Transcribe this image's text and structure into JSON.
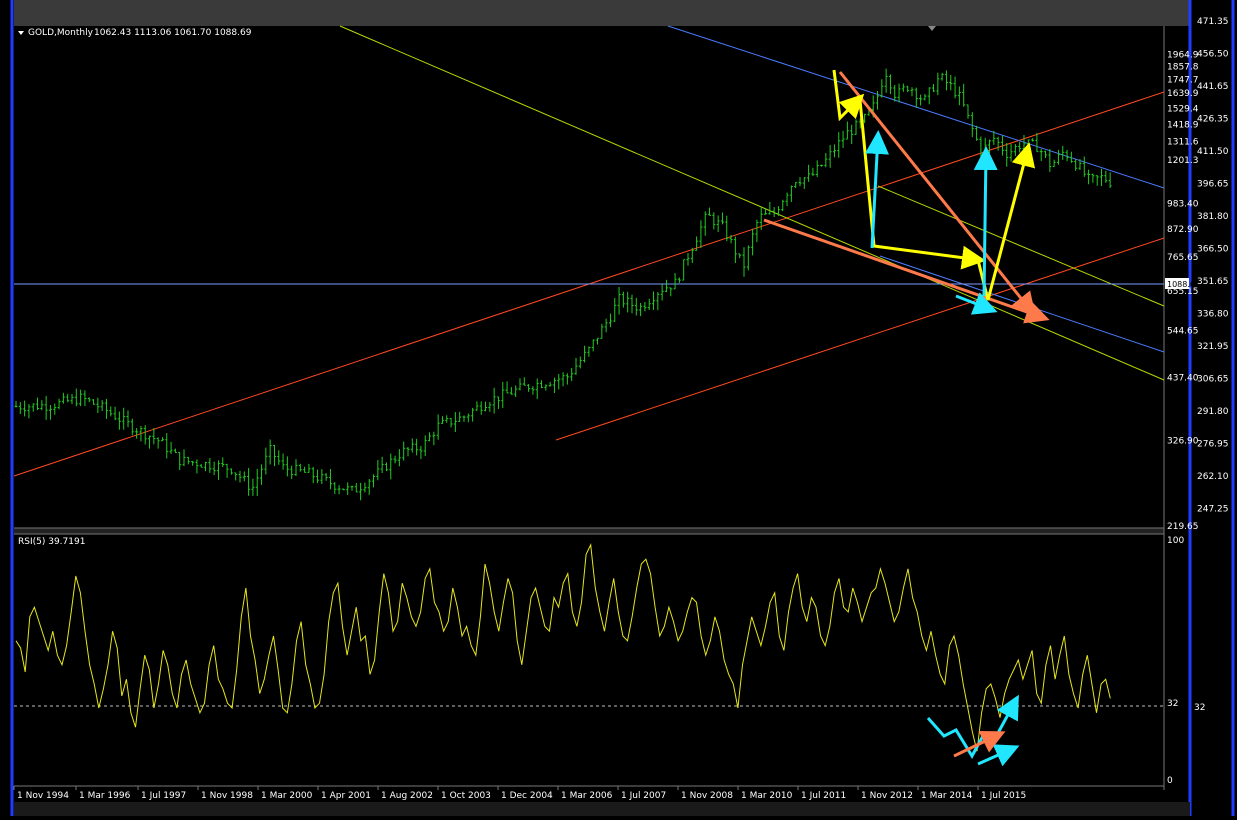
{
  "colors": {
    "background": "#000000",
    "frame_blue": "#1f3cff",
    "candle": "#22cc22",
    "rsi": "#e6e61a",
    "channel_orange": "#ff4a1f",
    "channel_yellowgreen": "#b8d800",
    "channel_blue": "#4a7cff",
    "arrow_yellow": "#ffff00",
    "arrow_cyan": "#20e6ff",
    "arrow_salmon": "#ff7a4a",
    "price_line": "#7a9cff"
  },
  "chart_data": [
    {
      "type": "candlestick",
      "title": "GOLD,Monthly",
      "ohlc_label": "1062.43 1113.06 1061.70 1088.69",
      "current_price_label": "1088.69",
      "current_price": 1088.69,
      "y_scale": "log",
      "ylim": [
        219.65,
        2200
      ],
      "y_ticks_right": [
        "1964.9",
        "1857.8",
        "1747.7",
        "1639.9",
        "1529.4",
        "1418.9",
        "1311.6",
        "1201.3",
        "983.40",
        "872.90",
        "765.65",
        "655.15",
        "544.65",
        "437.40",
        "326.90",
        "219.65"
      ],
      "y_ticks_far_right": [
        "471.35",
        "456.50",
        "441.65",
        "426.35",
        "411.50",
        "396.65",
        "381.80",
        "366.50",
        "351.65",
        "336.80",
        "321.95",
        "306.65",
        "291.80",
        "276.95",
        "262.10",
        "247.25"
      ],
      "x_ticks": [
        "1 Nov 1994",
        "1 Mar 1996",
        "1 Jul 1997",
        "1 Nov 1998",
        "1 Mar 2000",
        "1 Apr 2001",
        "1 Aug 2002",
        "1 Oct 2003",
        "1 Dec 2004",
        "1 Mar 2006",
        "1 Jul 2007",
        "1 Nov 2008",
        "1 Mar 2010",
        "1 Jul 2011",
        "1 Nov 2012",
        "1 Mar 2014",
        "1 Jul 2015"
      ],
      "x_start": 1994.83,
      "x_end": 2017.0,
      "price_path": [
        [
          1994.83,
          383
        ],
        [
          1995.5,
          385
        ],
        [
          1996.1,
          398
        ],
        [
          1996.5,
          380
        ],
        [
          1997.0,
          352
        ],
        [
          1997.6,
          326
        ],
        [
          1998.0,
          298
        ],
        [
          1998.6,
          292
        ],
        [
          1999.0,
          287
        ],
        [
          1999.4,
          261
        ],
        [
          1999.75,
          312
        ],
        [
          2000.0,
          288
        ],
        [
          2000.5,
          280
        ],
        [
          2001.0,
          266
        ],
        [
          2001.35,
          258
        ],
        [
          2001.8,
          279
        ],
        [
          2002.3,
          310
        ],
        [
          2002.7,
          318
        ],
        [
          2003.0,
          350
        ],
        [
          2003.5,
          365
        ],
        [
          2003.9,
          390
        ],
        [
          2004.3,
          405
        ],
        [
          2004.7,
          420
        ],
        [
          2005.0,
          427
        ],
        [
          2005.5,
          440
        ],
        [
          2005.9,
          495
        ],
        [
          2006.3,
          575
        ],
        [
          2006.5,
          630
        ],
        [
          2006.9,
          605
        ],
        [
          2007.3,
          660
        ],
        [
          2007.6,
          680
        ],
        [
          2007.9,
          800
        ],
        [
          2008.2,
          930
        ],
        [
          2008.5,
          880
        ],
        [
          2008.9,
          730
        ],
        [
          2009.2,
          920
        ],
        [
          2009.5,
          940
        ],
        [
          2009.9,
          1100
        ],
        [
          2010.2,
          1110
        ],
        [
          2010.5,
          1200
        ],
        [
          2010.9,
          1360
        ],
        [
          2011.2,
          1430
        ],
        [
          2011.45,
          1560
        ],
        [
          2011.65,
          1820
        ],
        [
          2011.85,
          1620
        ],
        [
          2012.1,
          1700
        ],
        [
          2012.4,
          1580
        ],
        [
          2012.7,
          1770
        ],
        [
          2012.95,
          1680
        ],
        [
          2013.1,
          1600
        ],
        [
          2013.3,
          1410
        ],
        [
          2013.5,
          1250
        ],
        [
          2013.75,
          1330
        ],
        [
          2014.0,
          1240
        ],
        [
          2014.3,
          1300
        ],
        [
          2014.6,
          1280
        ],
        [
          2014.85,
          1170
        ],
        [
          2015.1,
          1250
        ],
        [
          2015.35,
          1180
        ],
        [
          2015.6,
          1090
        ],
        [
          2015.85,
          1110
        ],
        [
          2016.0,
          1088
        ]
      ]
    },
    {
      "type": "line",
      "title": "RSI(5) 39.7191",
      "ylim": [
        0,
        100
      ],
      "y_ticks": [
        "100",
        "32",
        "0"
      ],
      "level": 32,
      "level_label": "32",
      "x_start": 1994.83,
      "x_end": 2017.0,
      "values": [
        58,
        55,
        45,
        68,
        72,
        66,
        60,
        54,
        62,
        52,
        48,
        56,
        70,
        85,
        78,
        62,
        48,
        40,
        30,
        38,
        48,
        62,
        55,
        35,
        42,
        28,
        22,
        38,
        52,
        46,
        30,
        40,
        54,
        48,
        36,
        30,
        44,
        50,
        40,
        34,
        28,
        32,
        48,
        56,
        42,
        38,
        32,
        30,
        46,
        68,
        80,
        60,
        50,
        36,
        42,
        52,
        60,
        46,
        30,
        28,
        40,
        58,
        66,
        48,
        40,
        30,
        32,
        44,
        66,
        78,
        82,
        64,
        52,
        62,
        72,
        58,
        60,
        44,
        50,
        70,
        86,
        78,
        62,
        66,
        82,
        76,
        68,
        64,
        70,
        84,
        88,
        74,
        70,
        62,
        66,
        80,
        72,
        60,
        64,
        56,
        52,
        68,
        90,
        82,
        70,
        62,
        74,
        84,
        78,
        58,
        48,
        62,
        76,
        80,
        72,
        64,
        62,
        76,
        72,
        82,
        86,
        70,
        64,
        74,
        94,
        98,
        80,
        70,
        62,
        74,
        84,
        70,
        60,
        58,
        68,
        80,
        90,
        92,
        86,
        72,
        60,
        64,
        72,
        66,
        58,
        62,
        70,
        76,
        74,
        60,
        52,
        58,
        68,
        62,
        50,
        44,
        40,
        30,
        48,
        58,
        68,
        62,
        56,
        64,
        74,
        78,
        60,
        54,
        70,
        80,
        86,
        72,
        66,
        76,
        72,
        60,
        56,
        64,
        78,
        84,
        72,
        70,
        80,
        74,
        66,
        72,
        78,
        80,
        88,
        82,
        74,
        66,
        70,
        80,
        88,
        76,
        70,
        60,
        54,
        62,
        52,
        44,
        40,
        56,
        60,
        52,
        40,
        30,
        20,
        12,
        28,
        38,
        40,
        34,
        26,
        36,
        42,
        46,
        50,
        42,
        48,
        54,
        36,
        32,
        48,
        56,
        42,
        52,
        60,
        44,
        36,
        30,
        44,
        52,
        40,
        28,
        40,
        42,
        34
      ]
    }
  ]
}
